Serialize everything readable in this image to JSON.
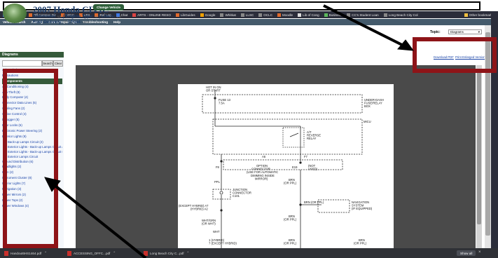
{
  "browser": {
    "bookmarks": [
      "Wiki",
      "Off-Campus Dir",
      "LBCC",
      "LBX",
      "Ref Log",
      "Chat",
      "ARTS - ONLINE RESO",
      "LibGuides",
      "Google",
      "Whitkat",
      "LLSC",
      "OCLC",
      "Moodle",
      "Lib of Cong",
      "Business",
      "CC's Student Loan",
      "Long Beach City Col"
    ],
    "other_bookmarks": "Other bookmarks"
  },
  "app_menu": [
    "Vehicle Search",
    "Auto IQ",
    "Care & Repair Tips",
    "Troubleshooting",
    "Help"
  ],
  "vehicle": {
    "title": "2007 Honda CIVIC",
    "change_button": "Change Vehicle",
    "submodel_label": "Submodel:",
    "submodel_value": "LX",
    "engine_label": "Engine Type:",
    "engine_value": "I4",
    "liters_label": "Liters:",
    "liters_value": "1.8",
    "fuel_delivery_label": "Fuel Delivery:",
    "fuel_delivery_value": "FI",
    "fuel_label": "Fuel:",
    "fuel_value": "GAS"
  },
  "topic": {
    "label": "Topic:",
    "value": "Diagrams"
  },
  "sidebar": {
    "header": "Diagrams",
    "search_button": "Search",
    "clear_button": "Clear",
    "items": [
      {
        "label": "Acknowledgments",
        "type": "item"
      },
      {
        "label": "Precautions",
        "type": "item"
      },
      {
        "label": "Components",
        "type": "section"
      },
      {
        "label": "Air Conditioning (4)",
        "type": "item"
      },
      {
        "label": "Anti-Theft (8)",
        "type": "item"
      },
      {
        "label": "Body Computer (4)",
        "type": "item"
      },
      {
        "label": "Connector Data Lines (5)",
        "type": "item"
      },
      {
        "label": "Cooling Fans (2)",
        "type": "item"
      },
      {
        "label": "Cruise Control (4)",
        "type": "item"
      },
      {
        "label": "Defogger (5)",
        "type": "item"
      },
      {
        "label": "Door Locks (6)",
        "type": "item"
      },
      {
        "label": "Electronic Power Steering (2)",
        "type": "item"
      },
      {
        "label": "Exterior Lights (9)",
        "type": "item"
      },
      {
        "label": "Back-up Lamps Circuit (2)",
        "type": "sub"
      },
      {
        "label": "Exterior Lights - Back-up Lamps Circuit A/T - 1 of 1 (1)",
        "type": "sub"
      },
      {
        "label": "Exterior Lights - Back-up Lamps Circuit M/T - 1 of 1 (1)",
        "type": "sub"
      },
      {
        "label": "Exterior Lamps Circuit",
        "type": "sub"
      },
      {
        "label": "Ground Distribution (6)",
        "type": "item"
      },
      {
        "label": "Headlights (2)",
        "type": "item"
      },
      {
        "label": "Horn (2)",
        "type": "item"
      },
      {
        "label": "Instrument Cluster (8)",
        "type": "item"
      },
      {
        "label": "Interior Lights (7)",
        "type": "item"
      },
      {
        "label": "Navigation (3)",
        "type": "item"
      },
      {
        "label": "Power Mirrors (2)",
        "type": "item"
      },
      {
        "label": "Power Tops (2)",
        "type": "item"
      },
      {
        "label": "Power Windows (4)",
        "type": "item"
      }
    ]
  },
  "toolbar": {
    "download_pdf": "Download PDF",
    "print_version": "Print Enlarged Version"
  },
  "diagram": {
    "hot_label": "HOT IN ON\nOR START",
    "fuse": "FUSE 13\n7.5A",
    "fuse_box": "UNDER-DASH\nFUSE/RELAY\nBOX",
    "micu": "MICU",
    "relay": "A/T\nREVERSE\nRELAY",
    "pin_a6": "A6",
    "pin_f7": "F7",
    "pin_f8": "F8",
    "pin_e19": "E19",
    "option_connector": "OPTION\nCONNECTOR\n(USE FOR AUTOMATIC\nDIMMING INSIDE\nMIRROR)",
    "not_used": "(NOT\nUSED)",
    "wire_ppl": "PPL",
    "wire_brn_orn": "BRN\n(OR PPL)",
    "junction": "JUNCTION\nCONNECTOR\nC101",
    "hybrid_pin": "(EXCEPT HYBRID) A7\n(HYBRID) A2",
    "brn_or_ppl_2": "BRN (OR PPL)",
    "nav_system": "NAVIGATION\nSYSTEM\n(IF EQUIPPED)",
    "wht_grn": "WHT/GRN\n(OR WHT)",
    "wht": "WHT",
    "hybrid_pins_bottom": "1 (HYBRID)\n7 (EXCEPT HYBRID)",
    "brn_bottom": "BRN\n(OR PPL)",
    "brn_bottom_2": "BRN\n(OR PPL)"
  },
  "downloads": {
    "items": [
      "Handout6HS1464.pdf",
      "ACCESSING_OFFC...pdf",
      "Long Beach City C...pdf"
    ],
    "show_all": "Show all",
    "close": "×"
  }
}
